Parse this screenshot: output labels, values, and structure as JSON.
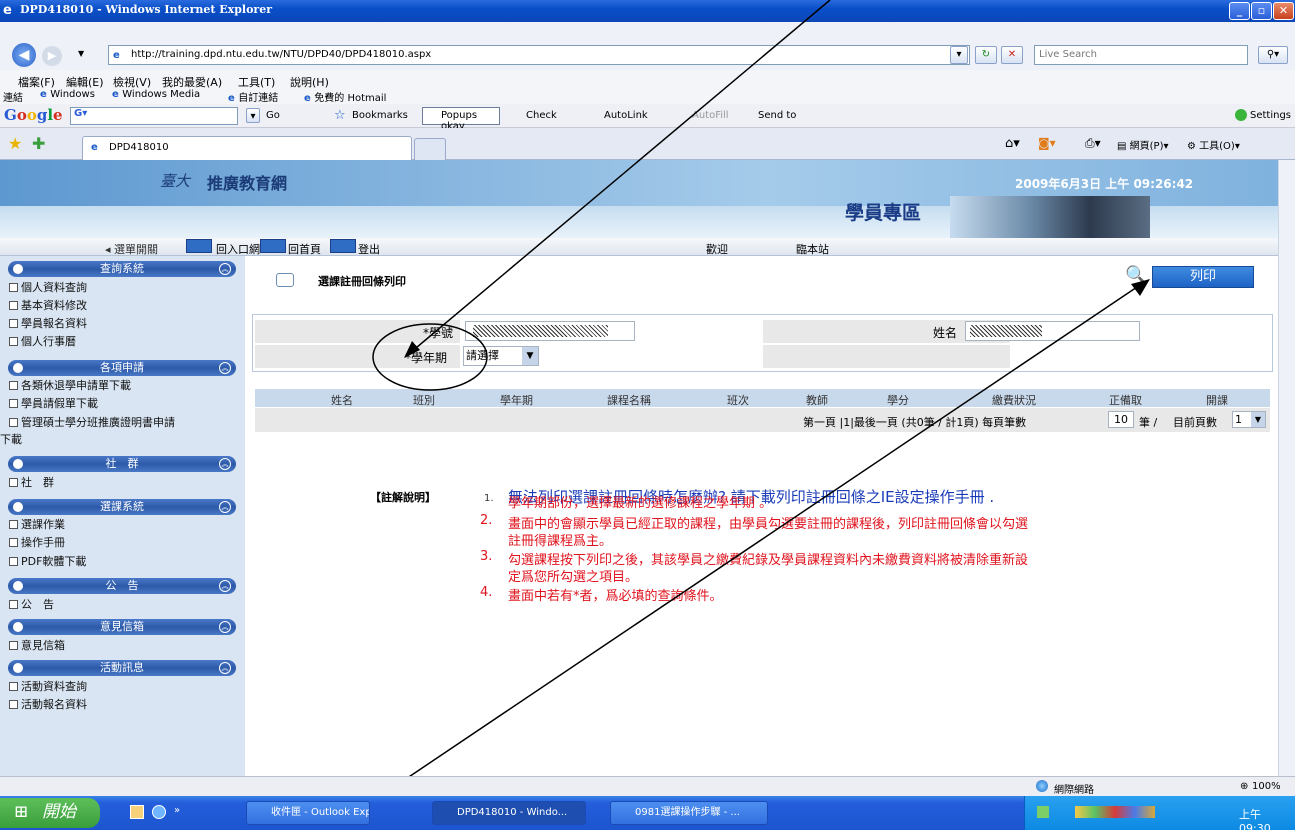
{
  "window": {
    "title": "DPD418010 - Windows Internet Explorer"
  },
  "address_bar": {
    "url": "http://training.dpd.ntu.edu.tw/NTU/DPD40/DPD418010.aspx",
    "search_placeholder": "Live Search"
  },
  "menu": [
    "檔案(F)",
    "編輯(E)",
    "檢視(V)",
    "我的最愛(A)",
    "工具(T)",
    "說明(H)"
  ],
  "links": {
    "label": "連結",
    "items": [
      "Windows",
      "Windows Media",
      "自訂連結",
      "免費的 Hotmail"
    ]
  },
  "google_toolbar": {
    "go": "Go",
    "bookmarks": "Bookmarks",
    "popups": "Popups okay",
    "check": "Check",
    "autolink": "AutoLink",
    "autofill": "AutoFill",
    "sendto": "Send to",
    "settings": "Settings"
  },
  "tab": {
    "label": "DPD418010"
  },
  "ie_cmd": {
    "page": "網頁(P)",
    "tools": "工具(O)"
  },
  "header": {
    "logo": "推廣教育網",
    "datetime": "2009年6月3日 上午 09:26:42",
    "banner_title": "學員專區"
  },
  "nav": {
    "menu_toggle": "選單開關",
    "portal": "回入口網",
    "home": "回首頁",
    "logout": "登出",
    "welcome": "歡迎",
    "welcome_suffix": "臨本站"
  },
  "sidebar": {
    "sections": [
      {
        "title": "查詢系統",
        "items": [
          "個人資料查詢",
          "基本資料修改",
          "學員報名資料",
          "個人行事曆"
        ]
      },
      {
        "title": "各項申請",
        "items": [
          "各類休退學申請單下載",
          "學員請假單下載",
          "管理碩士學分班推廣證明書申請",
          "下載"
        ]
      },
      {
        "title": "社　群",
        "items": [
          "社　群"
        ]
      },
      {
        "title": "選課系統",
        "items": [
          "選課作業",
          "操作手冊",
          "PDF軟體下載"
        ]
      },
      {
        "title": "公　告",
        "items": [
          "公　告"
        ]
      },
      {
        "title": "意見信箱",
        "items": [
          "意見信箱"
        ]
      },
      {
        "title": "活動訊息",
        "items": [
          "活動資料查詢",
          "活動報名資料"
        ]
      }
    ]
  },
  "main": {
    "page_title": "選課註冊回條列印",
    "print_button": "列印",
    "form": {
      "student_id_label": "*學號",
      "name_label": "姓名",
      "term_label": "*學年期",
      "term_value": "請選擇"
    },
    "table_headers": [
      "姓名",
      "班別",
      "學年期",
      "課程名稱",
      "班次",
      "教師",
      "學分",
      "繳費狀況",
      "正備取",
      "開課"
    ],
    "pager": {
      "text": "第一頁 |1|最後一頁 (共0筆 / 計1頁) 每頁筆數",
      "per_page": "10",
      "per_page_unit": "筆 /",
      "current_label": "目前頁數",
      "current_page": "1"
    },
    "notes": {
      "label": "【註解說明】",
      "headline": "無法列印選課註冊回條時怎麼辦? 請下載列印註冊回條之IE設定操作手冊 .",
      "items": [
        {
          "num": "1.",
          "text": "學年期部份，選擇最新的選修課程之學年期 。"
        },
        {
          "num": "2.",
          "text": "畫面中的會顯示學員已經正取的課程，由學員勾選要註冊的課程後，列印註冊回條會以勾選"
        },
        {
          "num": "",
          "text": "註冊得課程爲主。"
        },
        {
          "num": "3.",
          "text": "勾選課程按下列印之後，其該學員之繳費紀錄及學員課程資料內未繳費資料將被清除重新設"
        },
        {
          "num": "",
          "text": "定爲您所勾選之項目。"
        },
        {
          "num": "4.",
          "text": "畫面中若有*者，爲必填的查詢條件。"
        }
      ]
    }
  },
  "status": {
    "zone": "網際網路",
    "zoom": "100%"
  },
  "taskbar": {
    "start": "開始",
    "buttons": [
      "收件匣 - Outlook Exp...",
      "DPD418010 - Windo...",
      "0981選課操作步驟 - ..."
    ],
    "clock": "上午 09:30"
  }
}
